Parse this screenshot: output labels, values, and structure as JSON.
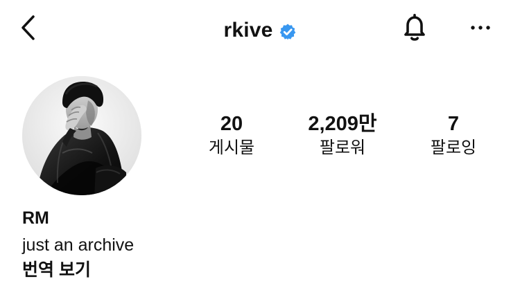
{
  "header": {
    "username": "rkive",
    "verified_color": "#3897F0",
    "icons": {
      "back": "back-arrow-icon",
      "verified": "verified-badge-icon",
      "notifications": "bell-icon",
      "more": "more-options-icon"
    }
  },
  "profile": {
    "stats": [
      {
        "value": "20",
        "label": "게시물"
      },
      {
        "value": "2,209만",
        "label": "팔로워"
      },
      {
        "value": "7",
        "label": "팔로잉"
      }
    ],
    "bio": {
      "name": "RM",
      "text": "just an archive",
      "translate_label": "번역 보기"
    }
  }
}
